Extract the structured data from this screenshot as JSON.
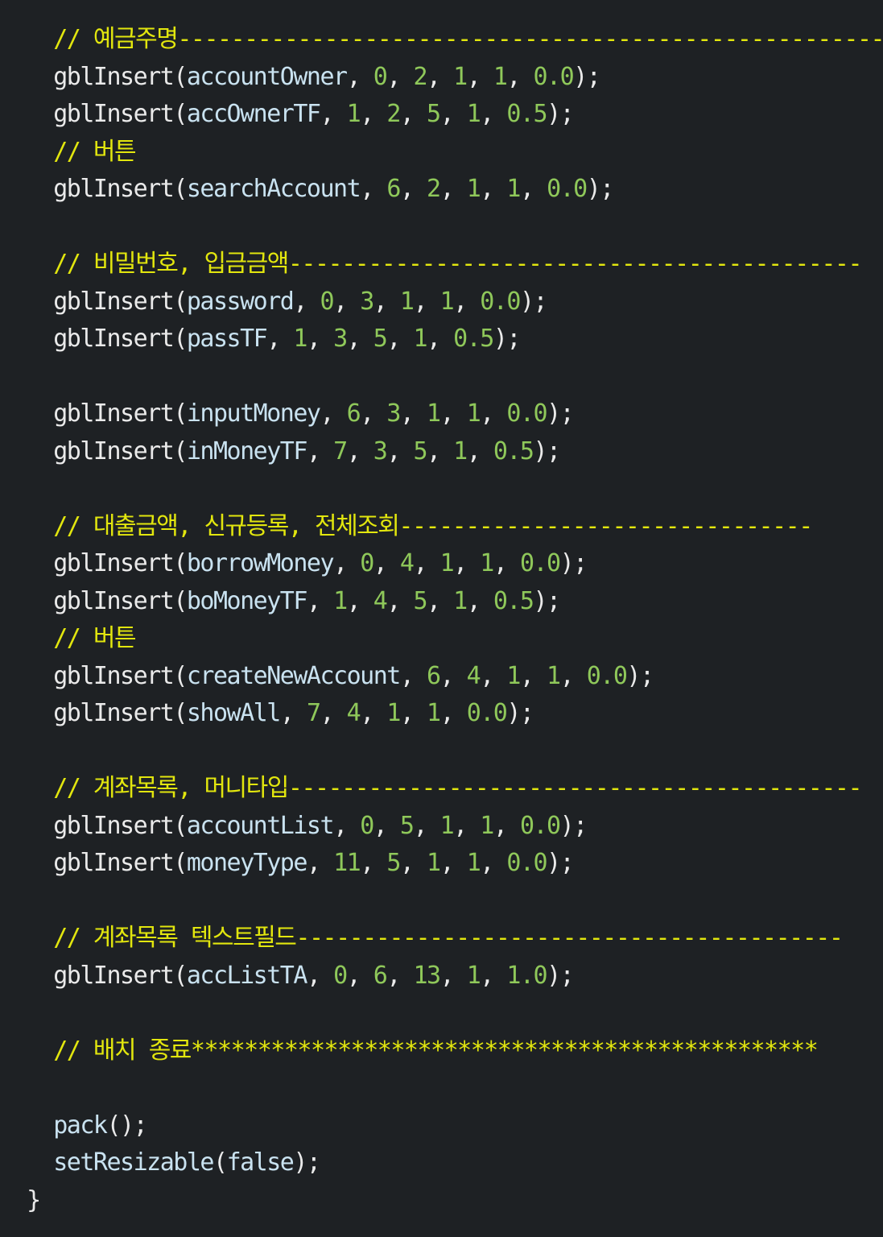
{
  "colors": {
    "background": "#1e2124",
    "comment": "#e2e60e",
    "function": "#eaeaea",
    "identifier": "#c9e2f0",
    "punctuation": "#eaeaea",
    "number": "#8fc85a"
  },
  "editor": {
    "lines": [
      {
        "indent": "    ",
        "tokens": [
          {
            "t": "comment",
            "v": "// 예금주명-----------------------------------------------------"
          }
        ]
      },
      {
        "indent": "    ",
        "tokens": [
          {
            "t": "func",
            "v": "gblInsert"
          },
          {
            "t": "punct",
            "v": "("
          },
          {
            "t": "ident",
            "v": "accountOwner"
          },
          {
            "t": "punct",
            "v": ", "
          },
          {
            "t": "num",
            "v": "0"
          },
          {
            "t": "punct",
            "v": ", "
          },
          {
            "t": "num",
            "v": "2"
          },
          {
            "t": "punct",
            "v": ", "
          },
          {
            "t": "num",
            "v": "1"
          },
          {
            "t": "punct",
            "v": ", "
          },
          {
            "t": "num",
            "v": "1"
          },
          {
            "t": "punct",
            "v": ", "
          },
          {
            "t": "num",
            "v": "0.0"
          },
          {
            "t": "punct",
            "v": ");"
          }
        ]
      },
      {
        "indent": "    ",
        "tokens": [
          {
            "t": "func",
            "v": "gblInsert"
          },
          {
            "t": "punct",
            "v": "("
          },
          {
            "t": "ident",
            "v": "accOwnerTF"
          },
          {
            "t": "punct",
            "v": ", "
          },
          {
            "t": "num",
            "v": "1"
          },
          {
            "t": "punct",
            "v": ", "
          },
          {
            "t": "num",
            "v": "2"
          },
          {
            "t": "punct",
            "v": ", "
          },
          {
            "t": "num",
            "v": "5"
          },
          {
            "t": "punct",
            "v": ", "
          },
          {
            "t": "num",
            "v": "1"
          },
          {
            "t": "punct",
            "v": ", "
          },
          {
            "t": "num",
            "v": "0.5"
          },
          {
            "t": "punct",
            "v": ");"
          }
        ]
      },
      {
        "indent": "    ",
        "tokens": [
          {
            "t": "comment",
            "v": "// 버튼"
          }
        ]
      },
      {
        "indent": "    ",
        "tokens": [
          {
            "t": "func",
            "v": "gblInsert"
          },
          {
            "t": "punct",
            "v": "("
          },
          {
            "t": "ident",
            "v": "searchAccount"
          },
          {
            "t": "punct",
            "v": ", "
          },
          {
            "t": "num",
            "v": "6"
          },
          {
            "t": "punct",
            "v": ", "
          },
          {
            "t": "num",
            "v": "2"
          },
          {
            "t": "punct",
            "v": ", "
          },
          {
            "t": "num",
            "v": "1"
          },
          {
            "t": "punct",
            "v": ", "
          },
          {
            "t": "num",
            "v": "1"
          },
          {
            "t": "punct",
            "v": ", "
          },
          {
            "t": "num",
            "v": "0.0"
          },
          {
            "t": "punct",
            "v": ");"
          }
        ]
      },
      {
        "indent": "",
        "tokens": []
      },
      {
        "indent": "    ",
        "tokens": [
          {
            "t": "comment",
            "v": "// 비밀번호, 입금금액-------------------------------------------"
          }
        ]
      },
      {
        "indent": "    ",
        "tokens": [
          {
            "t": "func",
            "v": "gblInsert"
          },
          {
            "t": "punct",
            "v": "("
          },
          {
            "t": "ident",
            "v": "password"
          },
          {
            "t": "punct",
            "v": ", "
          },
          {
            "t": "num",
            "v": "0"
          },
          {
            "t": "punct",
            "v": ", "
          },
          {
            "t": "num",
            "v": "3"
          },
          {
            "t": "punct",
            "v": ", "
          },
          {
            "t": "num",
            "v": "1"
          },
          {
            "t": "punct",
            "v": ", "
          },
          {
            "t": "num",
            "v": "1"
          },
          {
            "t": "punct",
            "v": ", "
          },
          {
            "t": "num",
            "v": "0.0"
          },
          {
            "t": "punct",
            "v": ");"
          }
        ]
      },
      {
        "indent": "    ",
        "tokens": [
          {
            "t": "func",
            "v": "gblInsert"
          },
          {
            "t": "punct",
            "v": "("
          },
          {
            "t": "ident",
            "v": "passTF"
          },
          {
            "t": "punct",
            "v": ", "
          },
          {
            "t": "num",
            "v": "1"
          },
          {
            "t": "punct",
            "v": ", "
          },
          {
            "t": "num",
            "v": "3"
          },
          {
            "t": "punct",
            "v": ", "
          },
          {
            "t": "num",
            "v": "5"
          },
          {
            "t": "punct",
            "v": ", "
          },
          {
            "t": "num",
            "v": "1"
          },
          {
            "t": "punct",
            "v": ", "
          },
          {
            "t": "num",
            "v": "0.5"
          },
          {
            "t": "punct",
            "v": ");"
          }
        ]
      },
      {
        "indent": "",
        "tokens": []
      },
      {
        "indent": "    ",
        "tokens": [
          {
            "t": "func",
            "v": "gblInsert"
          },
          {
            "t": "punct",
            "v": "("
          },
          {
            "t": "ident",
            "v": "inputMoney"
          },
          {
            "t": "punct",
            "v": ", "
          },
          {
            "t": "num",
            "v": "6"
          },
          {
            "t": "punct",
            "v": ", "
          },
          {
            "t": "num",
            "v": "3"
          },
          {
            "t": "punct",
            "v": ", "
          },
          {
            "t": "num",
            "v": "1"
          },
          {
            "t": "punct",
            "v": ", "
          },
          {
            "t": "num",
            "v": "1"
          },
          {
            "t": "punct",
            "v": ", "
          },
          {
            "t": "num",
            "v": "0.0"
          },
          {
            "t": "punct",
            "v": ");"
          }
        ]
      },
      {
        "indent": "    ",
        "tokens": [
          {
            "t": "func",
            "v": "gblInsert"
          },
          {
            "t": "punct",
            "v": "("
          },
          {
            "t": "ident",
            "v": "inMoneyTF"
          },
          {
            "t": "punct",
            "v": ", "
          },
          {
            "t": "num",
            "v": "7"
          },
          {
            "t": "punct",
            "v": ", "
          },
          {
            "t": "num",
            "v": "3"
          },
          {
            "t": "punct",
            "v": ", "
          },
          {
            "t": "num",
            "v": "5"
          },
          {
            "t": "punct",
            "v": ", "
          },
          {
            "t": "num",
            "v": "1"
          },
          {
            "t": "punct",
            "v": ", "
          },
          {
            "t": "num",
            "v": "0.5"
          },
          {
            "t": "punct",
            "v": ");"
          }
        ]
      },
      {
        "indent": "",
        "tokens": []
      },
      {
        "indent": "    ",
        "tokens": [
          {
            "t": "comment",
            "v": "// 대출금액, 신규등록, 전체조회-------------------------------"
          }
        ]
      },
      {
        "indent": "    ",
        "tokens": [
          {
            "t": "func",
            "v": "gblInsert"
          },
          {
            "t": "punct",
            "v": "("
          },
          {
            "t": "ident",
            "v": "borrowMoney"
          },
          {
            "t": "punct",
            "v": ", "
          },
          {
            "t": "num",
            "v": "0"
          },
          {
            "t": "punct",
            "v": ", "
          },
          {
            "t": "num",
            "v": "4"
          },
          {
            "t": "punct",
            "v": ", "
          },
          {
            "t": "num",
            "v": "1"
          },
          {
            "t": "punct",
            "v": ", "
          },
          {
            "t": "num",
            "v": "1"
          },
          {
            "t": "punct",
            "v": ", "
          },
          {
            "t": "num",
            "v": "0.0"
          },
          {
            "t": "punct",
            "v": ");"
          }
        ]
      },
      {
        "indent": "    ",
        "tokens": [
          {
            "t": "func",
            "v": "gblInsert"
          },
          {
            "t": "punct",
            "v": "("
          },
          {
            "t": "ident",
            "v": "boMoneyTF"
          },
          {
            "t": "punct",
            "v": ", "
          },
          {
            "t": "num",
            "v": "1"
          },
          {
            "t": "punct",
            "v": ", "
          },
          {
            "t": "num",
            "v": "4"
          },
          {
            "t": "punct",
            "v": ", "
          },
          {
            "t": "num",
            "v": "5"
          },
          {
            "t": "punct",
            "v": ", "
          },
          {
            "t": "num",
            "v": "1"
          },
          {
            "t": "punct",
            "v": ", "
          },
          {
            "t": "num",
            "v": "0.5"
          },
          {
            "t": "punct",
            "v": ");"
          }
        ]
      },
      {
        "indent": "    ",
        "tokens": [
          {
            "t": "comment",
            "v": "// 버튼"
          }
        ]
      },
      {
        "indent": "    ",
        "tokens": [
          {
            "t": "func",
            "v": "gblInsert"
          },
          {
            "t": "punct",
            "v": "("
          },
          {
            "t": "ident",
            "v": "createNewAccount"
          },
          {
            "t": "punct",
            "v": ", "
          },
          {
            "t": "num",
            "v": "6"
          },
          {
            "t": "punct",
            "v": ", "
          },
          {
            "t": "num",
            "v": "4"
          },
          {
            "t": "punct",
            "v": ", "
          },
          {
            "t": "num",
            "v": "1"
          },
          {
            "t": "punct",
            "v": ", "
          },
          {
            "t": "num",
            "v": "1"
          },
          {
            "t": "punct",
            "v": ", "
          },
          {
            "t": "num",
            "v": "0.0"
          },
          {
            "t": "punct",
            "v": ");"
          }
        ]
      },
      {
        "indent": "    ",
        "tokens": [
          {
            "t": "func",
            "v": "gblInsert"
          },
          {
            "t": "punct",
            "v": "("
          },
          {
            "t": "ident",
            "v": "showAll"
          },
          {
            "t": "punct",
            "v": ", "
          },
          {
            "t": "num",
            "v": "7"
          },
          {
            "t": "punct",
            "v": ", "
          },
          {
            "t": "num",
            "v": "4"
          },
          {
            "t": "punct",
            "v": ", "
          },
          {
            "t": "num",
            "v": "1"
          },
          {
            "t": "punct",
            "v": ", "
          },
          {
            "t": "num",
            "v": "1"
          },
          {
            "t": "punct",
            "v": ", "
          },
          {
            "t": "num",
            "v": "0.0"
          },
          {
            "t": "punct",
            "v": ");"
          }
        ]
      },
      {
        "indent": "",
        "tokens": []
      },
      {
        "indent": "    ",
        "tokens": [
          {
            "t": "comment",
            "v": "// 계좌목록, 머니타입-------------------------------------------"
          }
        ]
      },
      {
        "indent": "    ",
        "tokens": [
          {
            "t": "func",
            "v": "gblInsert"
          },
          {
            "t": "punct",
            "v": "("
          },
          {
            "t": "ident",
            "v": "accountList"
          },
          {
            "t": "punct",
            "v": ", "
          },
          {
            "t": "num",
            "v": "0"
          },
          {
            "t": "punct",
            "v": ", "
          },
          {
            "t": "num",
            "v": "5"
          },
          {
            "t": "punct",
            "v": ", "
          },
          {
            "t": "num",
            "v": "1"
          },
          {
            "t": "punct",
            "v": ", "
          },
          {
            "t": "num",
            "v": "1"
          },
          {
            "t": "punct",
            "v": ", "
          },
          {
            "t": "num",
            "v": "0.0"
          },
          {
            "t": "punct",
            "v": ");"
          }
        ]
      },
      {
        "indent": "    ",
        "tokens": [
          {
            "t": "func",
            "v": "gblInsert"
          },
          {
            "t": "punct",
            "v": "("
          },
          {
            "t": "ident",
            "v": "moneyType"
          },
          {
            "t": "punct",
            "v": ", "
          },
          {
            "t": "num",
            "v": "11"
          },
          {
            "t": "punct",
            "v": ", "
          },
          {
            "t": "num",
            "v": "5"
          },
          {
            "t": "punct",
            "v": ", "
          },
          {
            "t": "num",
            "v": "1"
          },
          {
            "t": "punct",
            "v": ", "
          },
          {
            "t": "num",
            "v": "1"
          },
          {
            "t": "punct",
            "v": ", "
          },
          {
            "t": "num",
            "v": "0.0"
          },
          {
            "t": "punct",
            "v": ");"
          }
        ]
      },
      {
        "indent": "",
        "tokens": []
      },
      {
        "indent": "    ",
        "tokens": [
          {
            "t": "comment",
            "v": "// 계좌목록 텍스트필드-----------------------------------------"
          }
        ]
      },
      {
        "indent": "    ",
        "tokens": [
          {
            "t": "func",
            "v": "gblInsert"
          },
          {
            "t": "punct",
            "v": "("
          },
          {
            "t": "ident",
            "v": "accListTA"
          },
          {
            "t": "punct",
            "v": ", "
          },
          {
            "t": "num",
            "v": "0"
          },
          {
            "t": "punct",
            "v": ", "
          },
          {
            "t": "num",
            "v": "6"
          },
          {
            "t": "punct",
            "v": ", "
          },
          {
            "t": "num",
            "v": "13"
          },
          {
            "t": "punct",
            "v": ", "
          },
          {
            "t": "num",
            "v": "1"
          },
          {
            "t": "punct",
            "v": ", "
          },
          {
            "t": "num",
            "v": "1.0"
          },
          {
            "t": "punct",
            "v": ");"
          }
        ]
      },
      {
        "indent": "",
        "tokens": []
      },
      {
        "indent": "    ",
        "tokens": [
          {
            "t": "comment",
            "v": "// 배치 종료***********************************************"
          }
        ]
      },
      {
        "indent": "",
        "tokens": []
      },
      {
        "indent": "    ",
        "tokens": [
          {
            "t": "ident",
            "v": "pack"
          },
          {
            "t": "punct",
            "v": "();"
          }
        ]
      },
      {
        "indent": "    ",
        "tokens": [
          {
            "t": "ident",
            "v": "setResizable"
          },
          {
            "t": "punct",
            "v": "("
          },
          {
            "t": "keyword",
            "v": "false"
          },
          {
            "t": "punct",
            "v": ");"
          }
        ]
      },
      {
        "indent": "  ",
        "tokens": [
          {
            "t": "punct",
            "v": "}"
          }
        ]
      }
    ]
  }
}
